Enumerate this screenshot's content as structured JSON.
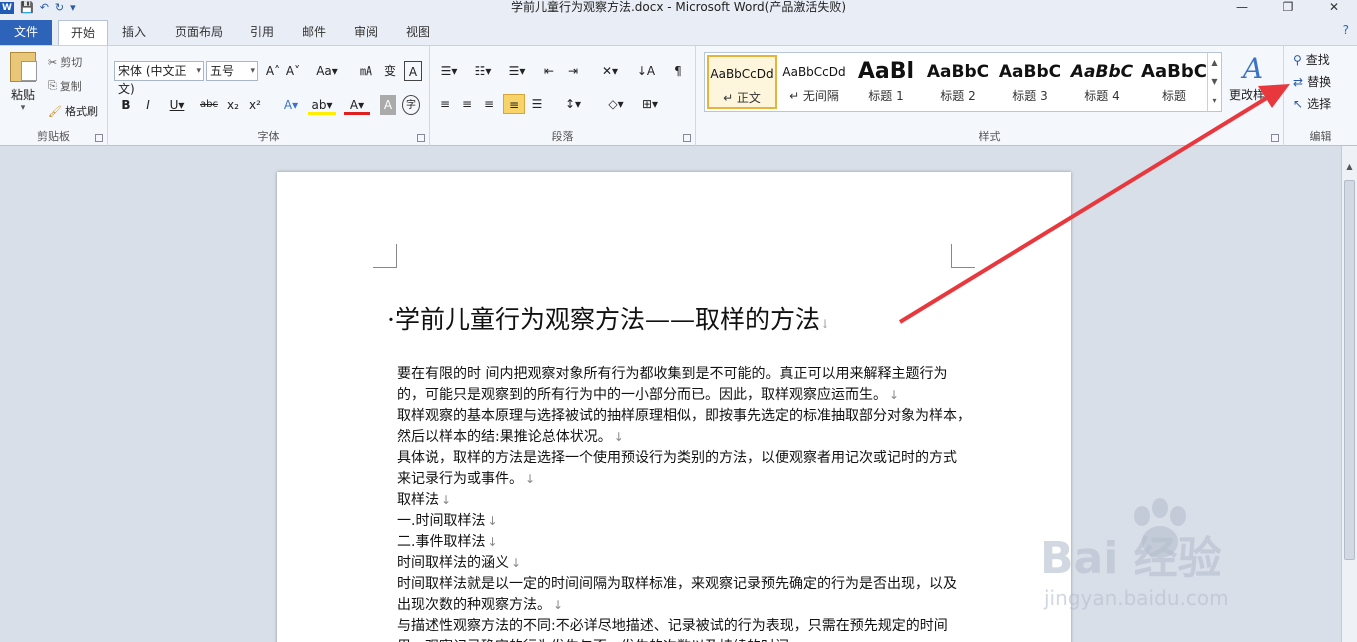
{
  "window": {
    "title": "学前儿童行为观察方法.docx - Microsoft Word(产品激活失败)",
    "controls": [
      "—",
      "❐",
      "✕"
    ]
  },
  "qat": {
    "app_icon": "W",
    "items": [
      "💾",
      "↶",
      "↻",
      "▾"
    ]
  },
  "tabs": {
    "file": "文件",
    "items": [
      "开始",
      "插入",
      "页面布局",
      "引用",
      "邮件",
      "审阅",
      "视图"
    ],
    "active": "开始",
    "help_icon": "?"
  },
  "ribbon": {
    "clipboard": {
      "paste": "粘贴",
      "cut": "剪切",
      "copy": "复制",
      "format_painter": "格式刷",
      "label": "剪贴板"
    },
    "font": {
      "font_name": "宋体 (中文正文)",
      "font_size": "五号",
      "row1_buttons": [
        "A˄",
        "A˅",
        "Aa▾",
        "㎃",
        "变",
        "A"
      ],
      "row2_buttons": [
        "B",
        "I",
        "U▾",
        "abc",
        "x₂",
        "x²",
        "A▾",
        "ab▾",
        "A▾",
        "A",
        "字"
      ],
      "label": "字体"
    },
    "paragraph": {
      "row1_buttons": [
        "☰▾",
        "☷▾",
        "☰▾",
        "⇤",
        "⇥",
        "✕▾",
        "↓A",
        "¶"
      ],
      "row2_buttons": [
        "≡",
        "≡",
        "≡",
        "≡",
        "☰",
        "↕▾",
        "◇▾",
        "⊞▾"
      ],
      "label": "段落"
    },
    "styles": {
      "tiles": [
        {
          "sample": "AaBbCcDd",
          "name": "↵ 正文",
          "active": true
        },
        {
          "sample": "AaBbCcDd",
          "name": "↵ 无间隔",
          "active": false
        },
        {
          "sample": "AaBl",
          "name": "标题 1",
          "active": false
        },
        {
          "sample": "AaBbC",
          "name": "标题 2",
          "active": false
        },
        {
          "sample": "AaBbC",
          "name": "标题 3",
          "active": false
        },
        {
          "sample": "AaBbC",
          "name": "标题 4",
          "active": false
        },
        {
          "sample": "AaBbC",
          "name": "标题",
          "active": false
        }
      ],
      "change_styles": "更改样式",
      "label": "样式"
    },
    "editing": {
      "find": "查找",
      "replace": "替换",
      "select": "选择",
      "label": "编辑"
    }
  },
  "document": {
    "title": "学前儿童行为观察方法——取样的方法",
    "lines": [
      "要在有限的时 间内把观察对象所有行为都收集到是不可能的。真正可以用来解释主题行为",
      "的，可能只是观察到的所有行为中的一小部分而已。因此，取样观察应运而生。",
      "取样观察的基本原理与选择被试的抽样原理相似，即按事先选定的标准抽取部分对象为样本，",
      "然后以样本的结:果推论总体状况。",
      "具体说，取样的方法是选择一个使用预设行为类别的方法，以便观察者用记次或记时的方式",
      "来记录行为或事件。",
      "取样法",
      "一.时间取样法",
      "二.事件取样法",
      "时间取样法的涵义",
      "时间取样法就是以一定的时间间隔为取样标准，来观察记录预先确定的行为是否出现，以及",
      "出现次数的种观察方法。",
      "与描述性观察方法的不同:不必详尽地描述、记录被试的行为表现，只需在预先规定的时间",
      "里，观察记录确定的行为发生与否、发生的次数以及持续的时间。"
    ],
    "paragraph_ends": [
      1,
      3,
      5,
      6,
      7,
      8,
      9,
      11,
      13
    ],
    "paragraph_mark": "↓"
  },
  "watermark": {
    "main": "Bai 经验",
    "sub": "jingyan.baidu.com"
  },
  "colors": {
    "accent": "#2d63b8",
    "arrow": "#e8383d",
    "selected": "#f7d36a"
  }
}
